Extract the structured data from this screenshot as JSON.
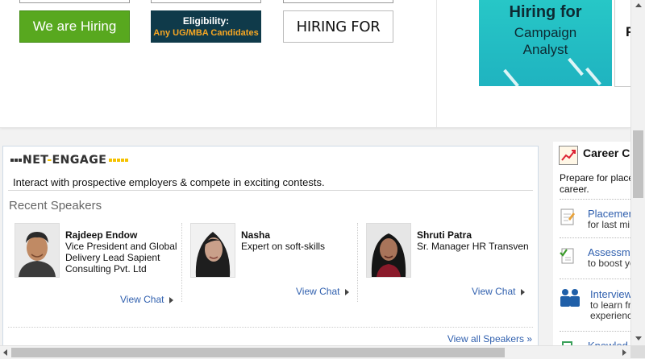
{
  "ads": {
    "hiring_label": "We are Hiring",
    "eligibility_line1": "Eligibility:",
    "eligibility_line2": "Any UG/MBA Candidates",
    "hiring_for_label": "HIRING FOR",
    "banner_title": "Hiring for",
    "banner_line2": "Campaign",
    "banner_line3": "Analyst",
    "banner2_letter": "F"
  },
  "net_engage": {
    "logo_part1": "NET",
    "logo_dash": "-",
    "logo_part2": "ENGAGE",
    "tagline": "Interact with prospective employers & compete in exciting contests.",
    "recent_title": "Recent Speakers",
    "speakers": [
      {
        "name": "Rajdeep Endow",
        "desc": "Vice President and Global Delivery Lead Sapient Consulting Pvt. Ltd",
        "chat_label": "View Chat"
      },
      {
        "name": "Nasha",
        "desc": "Expert on soft-skills",
        "chat_label": "View Chat"
      },
      {
        "name": "Shruti Patra",
        "desc": "Sr. Manager HR Transven",
        "chat_label": "View Chat"
      }
    ],
    "view_all": "View all Speakers »"
  },
  "sidebar": {
    "title": "Career C",
    "text_line1": "Prepare for place",
    "text_line2": "career.",
    "items": [
      {
        "title": "Placemen",
        "sub1": "for last mi",
        "sub2": ""
      },
      {
        "title": "Assessm",
        "sub1": "to boost yo",
        "sub2": ""
      },
      {
        "title": "Interview",
        "sub1": "to learn fr",
        "sub2": "experienc"
      },
      {
        "title": "Knowled",
        "sub1": "",
        "sub2": ""
      }
    ]
  },
  "colors": {
    "accent_link": "#2f5fae",
    "hiring_green": "#58a81f",
    "banner_teal": "#27c7c7",
    "logo_yellow": "#f5c200"
  }
}
